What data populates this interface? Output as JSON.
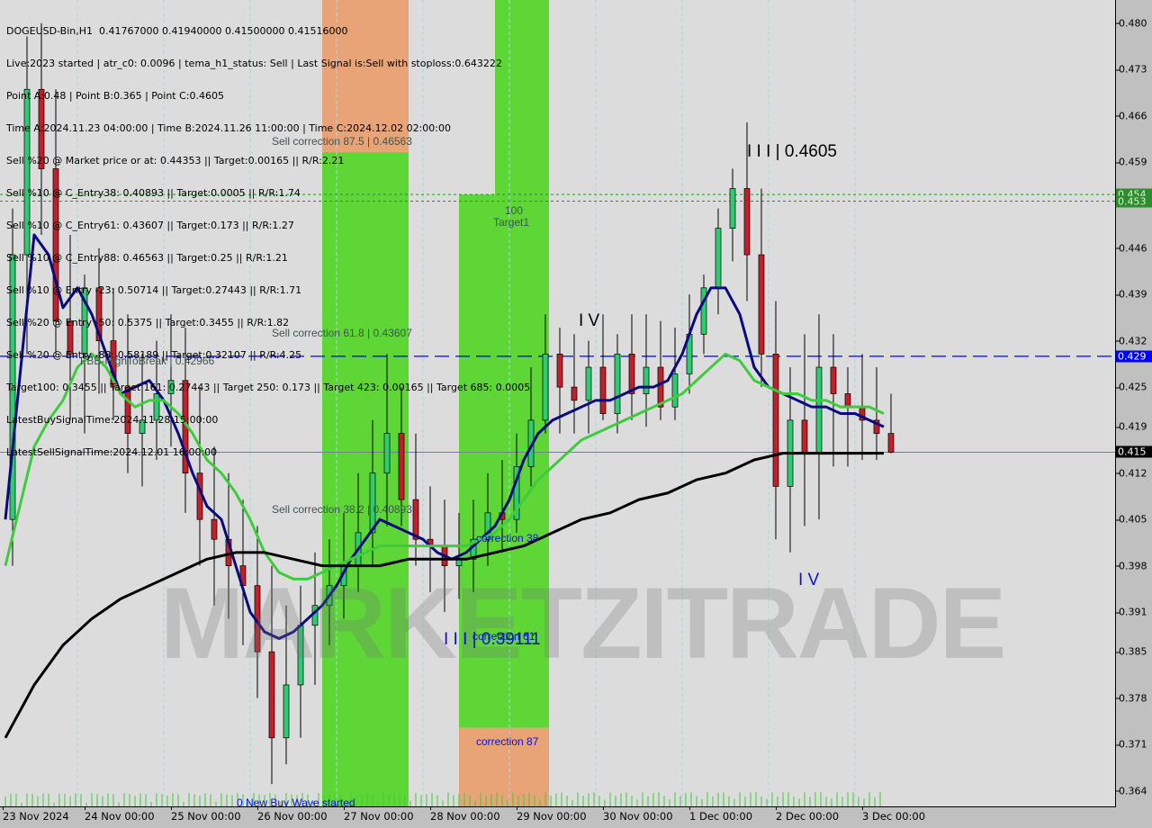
{
  "header": {
    "symbol_line": "DOGEUSD-Bin,H1  0.41767000 0.41940000 0.41500000 0.41516000",
    "info_lines": [
      "Live:2023 started | atr_c0: 0.0096 | tema_h1_status: Sell | Last Signal is:Sell with stoploss:0.643222",
      "Point A:0.48 | Point B:0.365 | Point C:0.4605",
      "Time A:2024.11.23 04:00:00 | Time B:2024.11.26 11:00:00 | Time C:2024.12.02 02:00:00",
      "Sell %20 @ Market price or at: 0.44353 || Target:0.00165 || R/R:2.21",
      "Sell %10 @ C_Entry38: 0.40893 || Target:0.0005 || R/R:1.74",
      "Sell %10 @ C_Entry61: 0.43607 || Target:0.173 || R/R:1.27",
      "Sell %10 @ C_Entry88: 0.46563 || Target:0.25 || R/R:1.21",
      "Sell %10 @ Entry -23: 0.50714 || Target:0.27443 || R/R:1.71",
      "Sell %20 @ Entry -50: 0.5375 || Target:0.3455 || R/R:1.82",
      "Sell %20 @ Entry -88: 0.58189 || Target:0.32107 || R/R:4.25",
      "Target100: 0.3455 || Target 161: 0.27443 || Target 250: 0.173 || Target 423: 0.00165 || Target 685: 0.0005",
      "LatestBuySignalTime:2024.11.28 15:00:00",
      "LatestSellSignalTime:2024.12.01 16:00:00"
    ]
  },
  "watermark": "MARKETZITRADE",
  "overlay_labels": {
    "sell_correction_875": "Sell correction 87.5 | 0.46563",
    "sell_correction_618": "Sell correction 61.8 | 0.43607",
    "sell_correction_382": "Sell correction 38.2 | 0.40893",
    "fbb_high_to_break": "FBB-HighToBreak | 0.42966",
    "target1_level": "100",
    "target1_label": "Target1",
    "correction_38": "correction 38",
    "correction_61": "correction 61",
    "correction_87": "correction 87",
    "new_buy_wave": "0 New Buy Wave started",
    "wave_iii_top": "I I I | 0.4605",
    "wave_iii_bottom": "I I I | 0.39111",
    "wave_iv_top": "I V",
    "wave_iv_bottom": "I V"
  },
  "colors": {
    "bull_candle": "#2ecc71",
    "bear_candle": "#c0202a",
    "ma_fast": "#0a0a80",
    "ma_mid": "#3ccc3c",
    "ma_slow": "#000000",
    "zone_green": "#56d62c",
    "zone_green_light": "#66e01c",
    "zone_orange": "#e8a070",
    "level_blue": "#0000ff",
    "level_green": "#2e8b2e",
    "current_price_badge": "#000000"
  },
  "chart_data": {
    "type": "candlestick",
    "title": "DOGEUSD-Bin,H1",
    "timeframe": "H1",
    "ohlc_last": {
      "open": 0.41767,
      "high": 0.4194,
      "low": 0.415,
      "close": 0.41516
    },
    "ylim": [
      0.3615,
      0.4835
    ],
    "y_ticks": [
      "0.480",
      "0.473",
      "0.466",
      "0.459",
      "0.446",
      "0.439",
      "0.432",
      "0.425",
      "0.419",
      "0.412",
      "0.405",
      "0.398",
      "0.391",
      "0.385",
      "0.378",
      "0.371",
      "0.364"
    ],
    "y_tick_values": [
      0.48,
      0.473,
      0.466,
      0.459,
      0.446,
      0.439,
      0.432,
      0.425,
      0.419,
      0.412,
      0.405,
      0.398,
      0.391,
      0.385,
      0.378,
      0.371,
      0.364
    ],
    "x_ticks": [
      "23 Nov 2024",
      "24 Nov 00:00",
      "25 Nov 00:00",
      "26 Nov 00:00",
      "27 Nov 00:00",
      "28 Nov 00:00",
      "29 Nov 00:00",
      "30 Nov 00:00",
      "1 Dec 00:00",
      "2 Dec 00:00",
      "3 Dec 00:00"
    ],
    "x_tick_hours": [
      0,
      20,
      44,
      68,
      92,
      116,
      140,
      164,
      188,
      212,
      236
    ],
    "price_badges": [
      {
        "label": "0.454",
        "value": 0.4541,
        "style": "green"
      },
      {
        "label": "0.453",
        "value": 0.4531,
        "style": "green"
      },
      {
        "label": "0.429",
        "value": 0.42966,
        "style": "blue"
      },
      {
        "label": "0.415",
        "value": 0.41516,
        "style": "black"
      }
    ],
    "horizontal_levels": [
      {
        "name": "fbb-high-to-break",
        "value": 0.42966,
        "style": "blue-dashed"
      },
      {
        "name": "target-line-1",
        "value": 0.4541,
        "style": "green-dotted"
      },
      {
        "name": "target-line-2",
        "value": 0.4531,
        "style": "green-dotted"
      },
      {
        "name": "current-price",
        "value": 0.41516,
        "style": "gray-solid"
      }
    ],
    "zones": [
      {
        "name": "orange-zone-top",
        "h0": 88,
        "h1": 112,
        "y0": 0.4835,
        "y1": 0.4605,
        "color": "orange"
      },
      {
        "name": "green-zone-a",
        "h0": 88,
        "h1": 112,
        "y0": 0.4605,
        "y1": 0.3615,
        "color": "green"
      },
      {
        "name": "green-zone-b-top",
        "h0": 136,
        "h1": 151,
        "y0": 0.4835,
        "y1": 0.4541,
        "color": "green"
      },
      {
        "name": "green-zone-b",
        "h0": 126,
        "h1": 151,
        "y0": 0.4541,
        "y1": 0.3735,
        "color": "green"
      },
      {
        "name": "orange-zone-bottom",
        "h0": 126,
        "h1": 151,
        "y0": 0.3735,
        "y1": 0.3615,
        "color": "orange"
      }
    ],
    "series": [
      {
        "name": "close",
        "type": "candlestick",
        "hours": [
          0,
          4,
          8,
          12,
          16,
          20,
          24,
          28,
          32,
          36,
          40,
          44,
          48,
          52,
          56,
          60,
          64,
          68,
          72,
          76,
          80,
          84,
          88,
          92,
          96,
          100,
          104,
          108,
          112,
          116,
          120,
          124,
          128,
          132,
          136,
          140,
          144,
          148,
          152,
          156,
          160,
          164,
          168,
          172,
          176,
          180,
          184,
          188,
          192,
          196,
          200,
          204,
          208,
          212,
          216,
          220,
          224,
          228,
          232,
          236,
          240,
          244
        ],
        "open": [
          0.405,
          0.445,
          0.47,
          0.458,
          0.435,
          0.43,
          0.44,
          0.432,
          0.425,
          0.418,
          0.42,
          0.424,
          0.426,
          0.412,
          0.405,
          0.402,
          0.398,
          0.395,
          0.385,
          0.372,
          0.38,
          0.389,
          0.392,
          0.395,
          0.398,
          0.403,
          0.412,
          0.418,
          0.408,
          0.402,
          0.401,
          0.398,
          0.399,
          0.402,
          0.406,
          0.405,
          0.413,
          0.42,
          0.43,
          0.425,
          0.423,
          0.428,
          0.421,
          0.43,
          0.424,
          0.428,
          0.422,
          0.427,
          0.433,
          0.44,
          0.449,
          0.455,
          0.445,
          0.43,
          0.41,
          0.42,
          0.415,
          0.428,
          0.424,
          0.422,
          0.42,
          0.418
        ],
        "high": [
          0.452,
          0.478,
          0.48,
          0.47,
          0.448,
          0.442,
          0.446,
          0.44,
          0.436,
          0.43,
          0.432,
          0.436,
          0.434,
          0.425,
          0.416,
          0.412,
          0.408,
          0.404,
          0.398,
          0.392,
          0.395,
          0.4,
          0.402,
          0.406,
          0.412,
          0.42,
          0.43,
          0.425,
          0.418,
          0.41,
          0.408,
          0.406,
          0.408,
          0.412,
          0.414,
          0.418,
          0.428,
          0.436,
          0.434,
          0.433,
          0.432,
          0.436,
          0.433,
          0.436,
          0.436,
          0.435,
          0.434,
          0.439,
          0.442,
          0.452,
          0.458,
          0.465,
          0.455,
          0.438,
          0.428,
          0.433,
          0.436,
          0.433,
          0.428,
          0.43,
          0.428,
          0.424
        ],
        "low": [
          0.398,
          0.43,
          0.448,
          0.43,
          0.42,
          0.418,
          0.424,
          0.42,
          0.412,
          0.41,
          0.414,
          0.416,
          0.406,
          0.398,
          0.392,
          0.39,
          0.386,
          0.378,
          0.365,
          0.368,
          0.372,
          0.38,
          0.386,
          0.39,
          0.394,
          0.398,
          0.404,
          0.404,
          0.398,
          0.394,
          0.391,
          0.393,
          0.394,
          0.398,
          0.4,
          0.403,
          0.41,
          0.418,
          0.418,
          0.418,
          0.418,
          0.42,
          0.418,
          0.42,
          0.419,
          0.42,
          0.42,
          0.424,
          0.43,
          0.436,
          0.444,
          0.438,
          0.425,
          0.402,
          0.4,
          0.404,
          0.405,
          0.413,
          0.413,
          0.414,
          0.414,
          0.415
        ],
        "close": [
          0.445,
          0.47,
          0.458,
          0.435,
          0.43,
          0.44,
          0.432,
          0.425,
          0.418,
          0.42,
          0.424,
          0.426,
          0.412,
          0.405,
          0.402,
          0.398,
          0.395,
          0.385,
          0.372,
          0.38,
          0.389,
          0.392,
          0.395,
          0.398,
          0.403,
          0.412,
          0.418,
          0.408,
          0.402,
          0.401,
          0.398,
          0.399,
          0.402,
          0.406,
          0.405,
          0.413,
          0.42,
          0.43,
          0.425,
          0.423,
          0.428,
          0.421,
          0.43,
          0.424,
          0.428,
          0.422,
          0.427,
          0.433,
          0.44,
          0.449,
          0.455,
          0.445,
          0.43,
          0.41,
          0.42,
          0.415,
          0.428,
          0.424,
          0.422,
          0.42,
          0.418,
          0.41516
        ]
      },
      {
        "name": "ma-fast-navy",
        "type": "line",
        "hours": [
          0,
          8,
          12,
          16,
          20,
          24,
          28,
          32,
          36,
          40,
          44,
          48,
          52,
          56,
          60,
          64,
          68,
          72,
          76,
          80,
          84,
          88,
          92,
          96,
          100,
          104,
          108,
          112,
          116,
          120,
          124,
          128,
          132,
          136,
          140,
          144,
          148,
          152,
          156,
          160,
          164,
          168,
          172,
          176,
          180,
          184,
          188,
          192,
          196,
          200,
          204,
          208,
          212,
          216,
          220,
          224,
          228,
          232,
          236,
          240,
          244
        ],
        "values": [
          0.405,
          0.448,
          0.445,
          0.437,
          0.44,
          0.436,
          0.43,
          0.424,
          0.425,
          0.426,
          0.423,
          0.418,
          0.412,
          0.407,
          0.405,
          0.398,
          0.391,
          0.388,
          0.387,
          0.388,
          0.39,
          0.392,
          0.395,
          0.399,
          0.402,
          0.405,
          0.404,
          0.403,
          0.402,
          0.4,
          0.399,
          0.4,
          0.402,
          0.404,
          0.408,
          0.414,
          0.418,
          0.42,
          0.421,
          0.422,
          0.423,
          0.423,
          0.424,
          0.425,
          0.425,
          0.426,
          0.43,
          0.436,
          0.44,
          0.44,
          0.436,
          0.428,
          0.425,
          0.424,
          0.423,
          0.422,
          0.422,
          0.421,
          0.421,
          0.42,
          0.419
        ]
      },
      {
        "name": "ma-mid-green",
        "type": "line",
        "hours": [
          0,
          8,
          12,
          16,
          20,
          24,
          28,
          32,
          36,
          40,
          44,
          48,
          52,
          56,
          60,
          64,
          68,
          72,
          76,
          80,
          84,
          88,
          92,
          96,
          100,
          104,
          108,
          112,
          116,
          120,
          124,
          128,
          132,
          136,
          140,
          144,
          148,
          152,
          156,
          160,
          164,
          168,
          172,
          176,
          180,
          184,
          188,
          192,
          196,
          200,
          204,
          208,
          212,
          216,
          220,
          224,
          228,
          232,
          236,
          240,
          244
        ],
        "values": [
          0.398,
          0.416,
          0.42,
          0.423,
          0.428,
          0.43,
          0.428,
          0.424,
          0.422,
          0.423,
          0.423,
          0.421,
          0.418,
          0.414,
          0.412,
          0.409,
          0.405,
          0.4,
          0.397,
          0.396,
          0.396,
          0.397,
          0.398,
          0.399,
          0.4,
          0.401,
          0.401,
          0.401,
          0.401,
          0.401,
          0.401,
          0.401,
          0.402,
          0.403,
          0.405,
          0.408,
          0.411,
          0.413,
          0.415,
          0.417,
          0.418,
          0.419,
          0.42,
          0.421,
          0.422,
          0.423,
          0.424,
          0.426,
          0.428,
          0.43,
          0.429,
          0.426,
          0.425,
          0.424,
          0.424,
          0.423,
          0.423,
          0.422,
          0.422,
          0.422,
          0.421
        ]
      },
      {
        "name": "ma-slow-black",
        "type": "line",
        "hours": [
          0,
          8,
          16,
          24,
          32,
          40,
          48,
          56,
          64,
          72,
          80,
          88,
          96,
          104,
          112,
          120,
          128,
          136,
          144,
          152,
          160,
          168,
          176,
          184,
          192,
          200,
          208,
          216,
          224,
          232,
          240,
          244
        ],
        "values": [
          0.372,
          0.38,
          0.386,
          0.39,
          0.393,
          0.395,
          0.397,
          0.399,
          0.4,
          0.4,
          0.399,
          0.398,
          0.398,
          0.398,
          0.399,
          0.399,
          0.399,
          0.4,
          0.401,
          0.403,
          0.405,
          0.406,
          0.408,
          0.409,
          0.411,
          0.412,
          0.414,
          0.415,
          0.415,
          0.415,
          0.415,
          0.415
        ]
      }
    ],
    "volume": {
      "name": "tick-volume",
      "color": "#3ccc3c",
      "scale_max": 100
    }
  }
}
